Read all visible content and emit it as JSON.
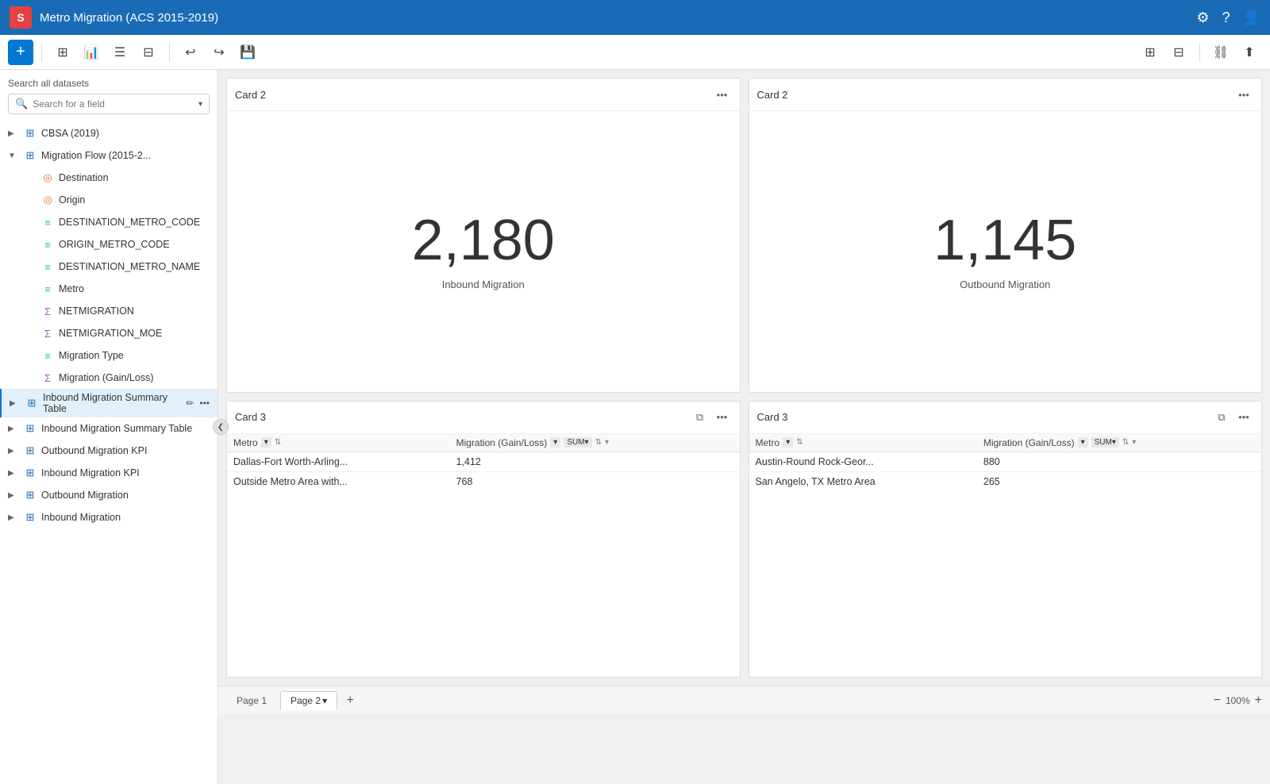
{
  "app": {
    "title": "Metro Migration (ACS 2015-2019)",
    "logo_text": "S"
  },
  "toolbar": {
    "add_label": "+",
    "undo_label": "↩",
    "redo_label": "↪",
    "save_label": "💾"
  },
  "sidebar": {
    "search_label": "Search all datasets",
    "search_placeholder": "Search for a field",
    "datasets": [
      {
        "id": "cbsa",
        "label": "CBSA (2019)",
        "icon": "table",
        "expandable": true,
        "indent": 0
      },
      {
        "id": "migflow",
        "label": "Migration Flow (2015-2...",
        "icon": "table",
        "expandable": true,
        "indent": 0,
        "expanded": true,
        "editable": true
      },
      {
        "id": "destination",
        "label": "Destination",
        "icon": "geo",
        "indent": 1
      },
      {
        "id": "origin",
        "label": "Origin",
        "icon": "geo",
        "indent": 1
      },
      {
        "id": "dest_metro_code",
        "label": "DESTINATION_METRO_CODE",
        "icon": "bars",
        "indent": 1
      },
      {
        "id": "orig_metro_code",
        "label": "ORIGIN_METRO_CODE",
        "icon": "bars",
        "indent": 1
      },
      {
        "id": "dest_metro_name",
        "label": "DESTINATION_METRO_NAME",
        "icon": "bars",
        "indent": 1
      },
      {
        "id": "metro",
        "label": "Metro",
        "icon": "bars",
        "indent": 1
      },
      {
        "id": "netmigration",
        "label": "NETMIGRATION",
        "icon": "sigma",
        "indent": 1
      },
      {
        "id": "netmigration_moe",
        "label": "NETMIGRATION_MOE",
        "icon": "sigma",
        "indent": 1
      },
      {
        "id": "migration_type",
        "label": "Migration Type",
        "icon": "bars",
        "indent": 1
      },
      {
        "id": "migration_gainloss",
        "label": "Migration (Gain/Loss)",
        "icon": "sigma",
        "indent": 1
      },
      {
        "id": "inbound_summary",
        "label": "Inbound Migration Summary Table",
        "icon": "table",
        "expandable": true,
        "indent": 0,
        "active_edit": true,
        "editable": true
      },
      {
        "id": "inbound_summary_table",
        "label": "Inbound Migration Summary Table",
        "icon": "table",
        "expandable": true,
        "indent": 0
      },
      {
        "id": "outbound_kpi",
        "label": "Outbound Migration KPI",
        "icon": "table",
        "expandable": true,
        "indent": 0
      },
      {
        "id": "inbound_kpi",
        "label": "Inbound Migration KPI",
        "icon": "table",
        "expandable": true,
        "indent": 0
      },
      {
        "id": "outbound_migration",
        "label": "Outbound Migration",
        "icon": "table",
        "expandable": true,
        "indent": 0
      },
      {
        "id": "inbound_migration",
        "label": "Inbound Migration",
        "icon": "table",
        "expandable": true,
        "indent": 0
      }
    ]
  },
  "cards": {
    "card1": {
      "title": "Card 2",
      "big_number": "2,180",
      "metric_label": "Inbound Migration"
    },
    "card2": {
      "title": "Card 2",
      "big_number": "1,145",
      "metric_label": "Outbound Migration"
    },
    "card3": {
      "title": "Card 3",
      "col1_label": "Metro",
      "col2_label": "Migration (Gain/Loss)",
      "col2_aggregate": "SUM",
      "rows": [
        {
          "metro": "Dallas-Fort Worth-Arling...",
          "value": "1,412"
        },
        {
          "metro": "Outside Metro Area with...",
          "value": "768"
        }
      ]
    },
    "card4": {
      "title": "Card 3",
      "col1_label": "Metro",
      "col2_label": "Migration (Gain/Loss)",
      "col2_aggregate": "SUM",
      "rows": [
        {
          "metro": "Austin-Round Rock-Geor...",
          "value": "880"
        },
        {
          "metro": "San Angelo, TX Metro Area",
          "value": "265"
        }
      ]
    }
  },
  "pages": {
    "tabs": [
      {
        "id": "page1",
        "label": "Page 1"
      },
      {
        "id": "page2",
        "label": "Page 2",
        "active": true
      }
    ],
    "zoom": "100%"
  },
  "icons": {
    "collapse": "❮",
    "more": "•••",
    "copy": "⧉",
    "sort_asc": "↑",
    "sort_both": "⇅",
    "zoom_in": "+",
    "zoom_out": "−",
    "settings": "⚙",
    "help": "?",
    "user": "👤",
    "dropdown": "▾",
    "expand_right": "▶",
    "expand_down": "▼"
  },
  "topbar_icons": [
    {
      "id": "settings",
      "symbol": "⚙"
    },
    {
      "id": "help",
      "symbol": "?"
    },
    {
      "id": "user",
      "symbol": "👤"
    }
  ]
}
